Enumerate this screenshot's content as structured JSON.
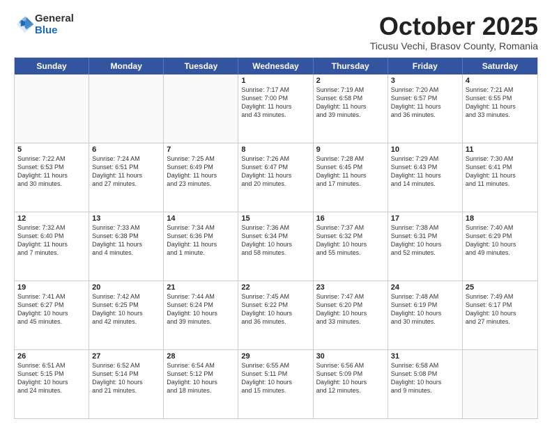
{
  "header": {
    "logo": {
      "line1": "General",
      "line2": "Blue"
    },
    "title": "October 2025",
    "subtitle": "Ticusu Vechi, Brasov County, Romania"
  },
  "weekdays": [
    "Sunday",
    "Monday",
    "Tuesday",
    "Wednesday",
    "Thursday",
    "Friday",
    "Saturday"
  ],
  "rows": [
    [
      {
        "day": "",
        "info": ""
      },
      {
        "day": "",
        "info": ""
      },
      {
        "day": "",
        "info": ""
      },
      {
        "day": "1",
        "info": "Sunrise: 7:17 AM\nSunset: 7:00 PM\nDaylight: 11 hours\nand 43 minutes."
      },
      {
        "day": "2",
        "info": "Sunrise: 7:19 AM\nSunset: 6:58 PM\nDaylight: 11 hours\nand 39 minutes."
      },
      {
        "day": "3",
        "info": "Sunrise: 7:20 AM\nSunset: 6:57 PM\nDaylight: 11 hours\nand 36 minutes."
      },
      {
        "day": "4",
        "info": "Sunrise: 7:21 AM\nSunset: 6:55 PM\nDaylight: 11 hours\nand 33 minutes."
      }
    ],
    [
      {
        "day": "5",
        "info": "Sunrise: 7:22 AM\nSunset: 6:53 PM\nDaylight: 11 hours\nand 30 minutes."
      },
      {
        "day": "6",
        "info": "Sunrise: 7:24 AM\nSunset: 6:51 PM\nDaylight: 11 hours\nand 27 minutes."
      },
      {
        "day": "7",
        "info": "Sunrise: 7:25 AM\nSunset: 6:49 PM\nDaylight: 11 hours\nand 23 minutes."
      },
      {
        "day": "8",
        "info": "Sunrise: 7:26 AM\nSunset: 6:47 PM\nDaylight: 11 hours\nand 20 minutes."
      },
      {
        "day": "9",
        "info": "Sunrise: 7:28 AM\nSunset: 6:45 PM\nDaylight: 11 hours\nand 17 minutes."
      },
      {
        "day": "10",
        "info": "Sunrise: 7:29 AM\nSunset: 6:43 PM\nDaylight: 11 hours\nand 14 minutes."
      },
      {
        "day": "11",
        "info": "Sunrise: 7:30 AM\nSunset: 6:41 PM\nDaylight: 11 hours\nand 11 minutes."
      }
    ],
    [
      {
        "day": "12",
        "info": "Sunrise: 7:32 AM\nSunset: 6:40 PM\nDaylight: 11 hours\nand 7 minutes."
      },
      {
        "day": "13",
        "info": "Sunrise: 7:33 AM\nSunset: 6:38 PM\nDaylight: 11 hours\nand 4 minutes."
      },
      {
        "day": "14",
        "info": "Sunrise: 7:34 AM\nSunset: 6:36 PM\nDaylight: 11 hours\nand 1 minute."
      },
      {
        "day": "15",
        "info": "Sunrise: 7:36 AM\nSunset: 6:34 PM\nDaylight: 10 hours\nand 58 minutes."
      },
      {
        "day": "16",
        "info": "Sunrise: 7:37 AM\nSunset: 6:32 PM\nDaylight: 10 hours\nand 55 minutes."
      },
      {
        "day": "17",
        "info": "Sunrise: 7:38 AM\nSunset: 6:31 PM\nDaylight: 10 hours\nand 52 minutes."
      },
      {
        "day": "18",
        "info": "Sunrise: 7:40 AM\nSunset: 6:29 PM\nDaylight: 10 hours\nand 49 minutes."
      }
    ],
    [
      {
        "day": "19",
        "info": "Sunrise: 7:41 AM\nSunset: 6:27 PM\nDaylight: 10 hours\nand 45 minutes."
      },
      {
        "day": "20",
        "info": "Sunrise: 7:42 AM\nSunset: 6:25 PM\nDaylight: 10 hours\nand 42 minutes."
      },
      {
        "day": "21",
        "info": "Sunrise: 7:44 AM\nSunset: 6:24 PM\nDaylight: 10 hours\nand 39 minutes."
      },
      {
        "day": "22",
        "info": "Sunrise: 7:45 AM\nSunset: 6:22 PM\nDaylight: 10 hours\nand 36 minutes."
      },
      {
        "day": "23",
        "info": "Sunrise: 7:47 AM\nSunset: 6:20 PM\nDaylight: 10 hours\nand 33 minutes."
      },
      {
        "day": "24",
        "info": "Sunrise: 7:48 AM\nSunset: 6:19 PM\nDaylight: 10 hours\nand 30 minutes."
      },
      {
        "day": "25",
        "info": "Sunrise: 7:49 AM\nSunset: 6:17 PM\nDaylight: 10 hours\nand 27 minutes."
      }
    ],
    [
      {
        "day": "26",
        "info": "Sunrise: 6:51 AM\nSunset: 5:15 PM\nDaylight: 10 hours\nand 24 minutes."
      },
      {
        "day": "27",
        "info": "Sunrise: 6:52 AM\nSunset: 5:14 PM\nDaylight: 10 hours\nand 21 minutes."
      },
      {
        "day": "28",
        "info": "Sunrise: 6:54 AM\nSunset: 5:12 PM\nDaylight: 10 hours\nand 18 minutes."
      },
      {
        "day": "29",
        "info": "Sunrise: 6:55 AM\nSunset: 5:11 PM\nDaylight: 10 hours\nand 15 minutes."
      },
      {
        "day": "30",
        "info": "Sunrise: 6:56 AM\nSunset: 5:09 PM\nDaylight: 10 hours\nand 12 minutes."
      },
      {
        "day": "31",
        "info": "Sunrise: 6:58 AM\nSunset: 5:08 PM\nDaylight: 10 hours\nand 9 minutes."
      },
      {
        "day": "",
        "info": ""
      }
    ]
  ]
}
